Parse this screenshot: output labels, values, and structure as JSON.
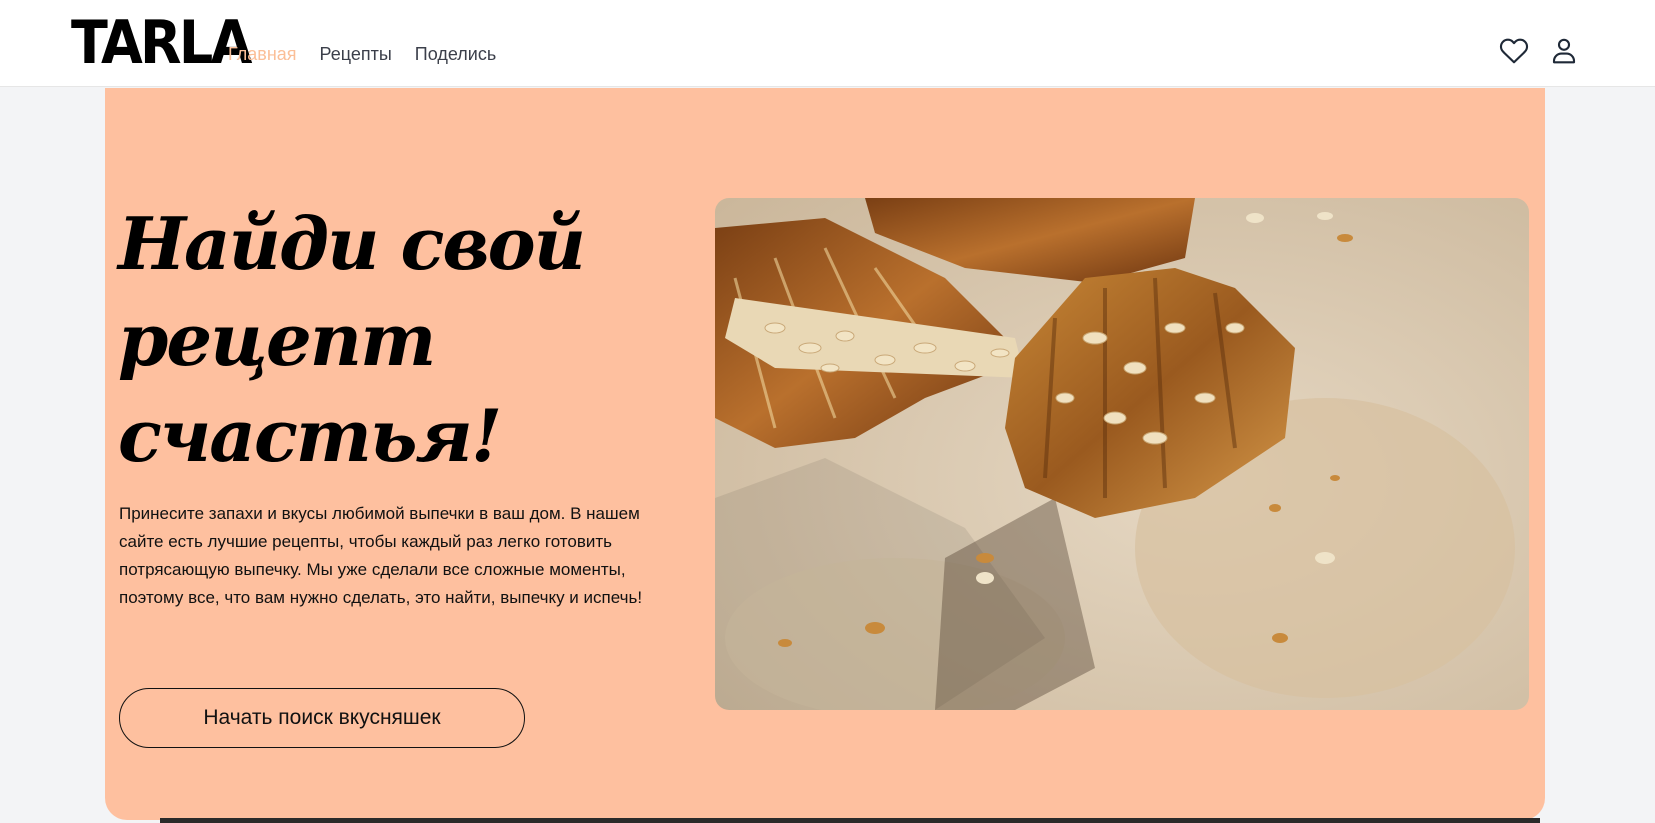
{
  "header": {
    "logo": "TARLA",
    "nav": [
      {
        "label": "Главная",
        "active": true
      },
      {
        "label": "Рецепты",
        "active": false
      },
      {
        "label": "Поделись",
        "active": false
      }
    ],
    "icons": [
      "heart-icon",
      "user-icon"
    ]
  },
  "hero": {
    "title": "Найди свой рецепт счастья!",
    "description": "Принесите запахи и вкусы любимой выпечки в ваш дом. В нашем сайте есть лучшие рецепты, чтобы каждый раз легко готовить потрясающую выпечку. Мы уже сделали все сложные моменты, поэтому все, что вам нужно сделать, это найти, выпечку и испечь!",
    "cta": "Начать поиск вкусняшек",
    "image": "croissants-photo"
  },
  "colors": {
    "accent": "#fec09f",
    "active_nav": "#fbbf98",
    "background": "#f3f4f6"
  }
}
